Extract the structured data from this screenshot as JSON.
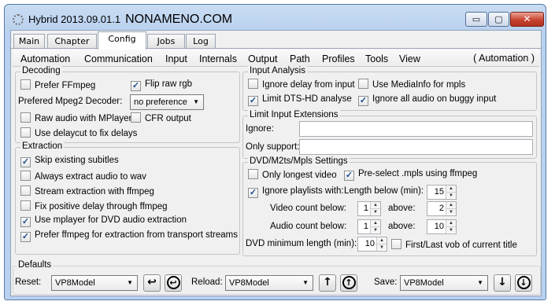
{
  "window": {
    "title": "Hybrid 2013.09.01.1",
    "title_suffix": "NONAMENO.COM",
    "controls": {
      "minimize": "▭",
      "maximize": "▢",
      "close": "✕"
    }
  },
  "tabs": [
    "Main",
    "Chapter",
    "Config",
    "Jobs",
    "Log"
  ],
  "active_tab": "Config",
  "subtabs": [
    "Automation",
    "Communication",
    "Input",
    "Internals",
    "Output",
    "Path",
    "Profiles",
    "Tools",
    "View"
  ],
  "subtab_current": "( Automation )",
  "decoding": {
    "title": "Decoding",
    "prefer_ffmpeg": {
      "label": "Prefer FFmpeg",
      "checked": false
    },
    "flip_raw_rgb": {
      "label": "Flip raw rgb",
      "checked": true
    },
    "mpeg2_label": "Prefered Mpeg2 Decoder:",
    "mpeg2_value": "no preference",
    "raw_audio": {
      "label": "Raw audio with MPlayer",
      "checked": false
    },
    "cfr_output": {
      "label": "CFR output",
      "checked": false
    },
    "delaycut": {
      "label": "Use delaycut to fix delays",
      "checked": false
    }
  },
  "extraction": {
    "title": "Extraction",
    "items": [
      {
        "label": "Skip existing subitles",
        "checked": true
      },
      {
        "label": "Always extract audio to wav",
        "checked": false
      },
      {
        "label": "Stream extraction with ffmpeg",
        "checked": false
      },
      {
        "label": "Fix positive delay through ffmpeg",
        "checked": false
      },
      {
        "label": "Use mplayer for DVD audio extraction",
        "checked": true
      },
      {
        "label": "Prefer ffmpeg for extraction from transport streams",
        "checked": true
      }
    ]
  },
  "input_analysis": {
    "title": "Input Analysis",
    "ignore_delay": {
      "label": "Ignore delay from input",
      "checked": false
    },
    "use_mediainfo": {
      "label": "Use MediaInfo for mpls",
      "checked": false
    },
    "limit_dts": {
      "label": "Limit DTS-HD analyse",
      "checked": true
    },
    "ignore_audio": {
      "label": "Ignore all audio on buggy input",
      "checked": true
    }
  },
  "limit_ext": {
    "title": "Limit Input Extensions",
    "ignore_label": "Ignore:",
    "ignore_value": "",
    "only_label": "Only support:",
    "only_value": ""
  },
  "dvd": {
    "title": "DVD/M2ts/Mpls Settings",
    "only_longest": {
      "label": "Only longest video",
      "checked": false
    },
    "preselect": {
      "label": "Pre-select .mpls using ffmpeg",
      "checked": true
    },
    "ignore_playlists": {
      "label": "Ignore playlists with:",
      "checked": true
    },
    "length_label": "Length below (min):",
    "length_value": "15",
    "video_count_label": "Video count below:",
    "video_count_value": "1",
    "video_above_label": "above:",
    "video_above_value": "2",
    "audio_count_label": "Audio count below:",
    "audio_count_value": "1",
    "audio_above_label": "above:",
    "audio_above_value": "10",
    "min_length_label": "DVD minimum length (min):",
    "min_length_value": "10",
    "first_last": {
      "label": "First/Last vob of current title",
      "checked": false
    }
  },
  "defaults": {
    "title": "Defaults",
    "reset_label": "Reset:",
    "reset_value": "VP8Model",
    "reload_label": "Reload:",
    "reload_value": "VP8Model",
    "save_label": "Save:",
    "save_value": "VP8Model"
  }
}
